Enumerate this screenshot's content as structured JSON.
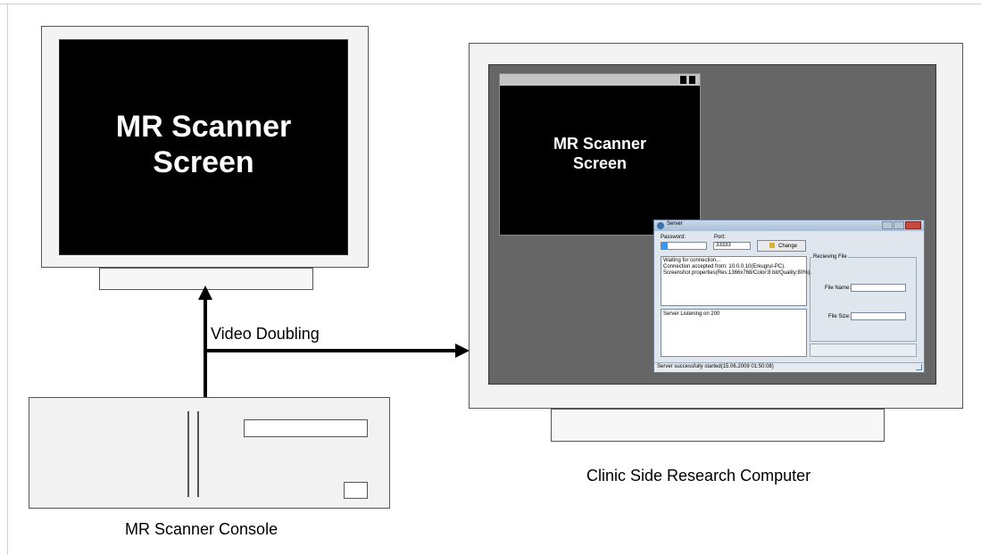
{
  "left_monitor": {
    "screen_text_line1": "MR Scanner",
    "screen_text_line2": "Screen"
  },
  "connection": {
    "label": "Video Doubling"
  },
  "console": {
    "label": "MR Scanner Console"
  },
  "right_monitor": {
    "label": "Clinic Side Research Computer",
    "inner_window": {
      "text_line1": "MR Scanner",
      "text_line2": "Screen"
    },
    "server_window": {
      "title": "Server",
      "password_label": "Password:",
      "port_label": "Port:",
      "port_value": "33333",
      "change_button": "Change",
      "log_lines": [
        "Waiting for connection...",
        "Connection accepted from: 10.0.0.10(Erkugrul-PC).",
        "Screenshot properties(Res:1366x768/Color:8 bit/Quality:80%)."
      ],
      "listen_text": "Server Listening on 200",
      "receiving_group": "Recieving File",
      "file_name_label": "File Name:",
      "file_size_label": "File Size:",
      "status_text": "Server successfully started(15.06.2009  01:50:08)"
    }
  },
  "colors": {
    "desktop": "#666666",
    "screen": "#000000",
    "device_fill": "#f3f3f3"
  }
}
